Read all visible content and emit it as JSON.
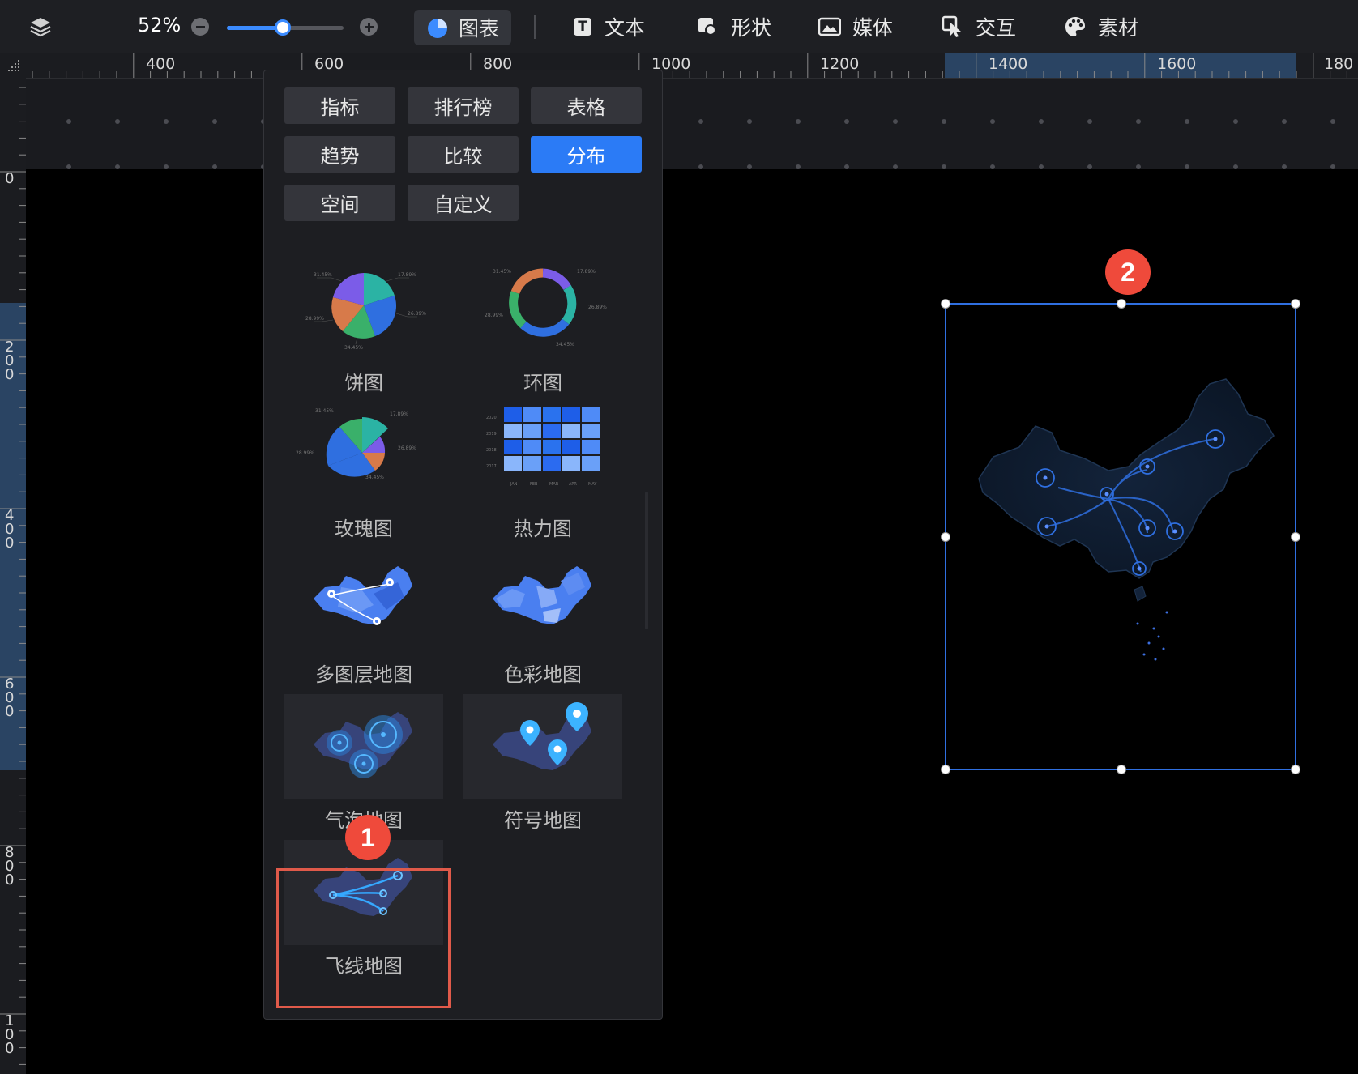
{
  "toolbar": {
    "zoom": "52%",
    "zoom_level": 0.48,
    "items": [
      {
        "label": "图表",
        "icon": "pie-chart-icon"
      },
      {
        "label": "文本",
        "icon": "text-icon"
      },
      {
        "label": "形状",
        "icon": "shape-icon"
      },
      {
        "label": "媒体",
        "icon": "media-icon"
      },
      {
        "label": "交互",
        "icon": "interaction-icon"
      },
      {
        "label": "素材",
        "icon": "palette-icon"
      }
    ]
  },
  "ruler": {
    "top_labels": [
      "400",
      "600",
      "800",
      "1000",
      "1200",
      "1400",
      "1600",
      "180"
    ],
    "left_labels": [
      "0",
      "200",
      "400",
      "600",
      "800",
      "100"
    ]
  },
  "panel": {
    "categories": [
      {
        "label": "指标",
        "active": false
      },
      {
        "label": "排行榜",
        "active": false
      },
      {
        "label": "表格",
        "active": false
      },
      {
        "label": "趋势",
        "active": false
      },
      {
        "label": "比较",
        "active": false
      },
      {
        "label": "分布",
        "active": true
      },
      {
        "label": "空间",
        "active": false
      },
      {
        "label": "自定义",
        "active": false
      }
    ],
    "charts": [
      {
        "label": "饼图",
        "thumb": "pie"
      },
      {
        "label": "环图",
        "thumb": "donut"
      },
      {
        "label": "玫瑰图",
        "thumb": "rose"
      },
      {
        "label": "热力图",
        "thumb": "heatmap"
      },
      {
        "label": "多图层地图",
        "thumb": "multilayer-map"
      },
      {
        "label": "色彩地图",
        "thumb": "color-map"
      },
      {
        "label": "气泡地图",
        "thumb": "bubble-map"
      },
      {
        "label": "符号地图",
        "thumb": "symbol-map"
      },
      {
        "label": "飞线地图",
        "thumb": "flyline-map"
      }
    ],
    "thumb_text": {
      "pct_a": "31.45%",
      "pct_b": "17.89%",
      "pct_c": "26.89%",
      "pct_d": "28.99%",
      "pct_e": "34.45%",
      "years": [
        "2020",
        "2019",
        "2018",
        "2017"
      ],
      "months": [
        "JAN",
        "FEB",
        "MAR",
        "APR",
        "MAY"
      ]
    }
  },
  "annotations": {
    "badge_1": "1",
    "badge_2": "2"
  },
  "colors": {
    "accent": "#2b7bf6",
    "highlight_frame": "#e05a4a",
    "badge": "#ef4a3b",
    "selection": "#2f6fe0"
  }
}
